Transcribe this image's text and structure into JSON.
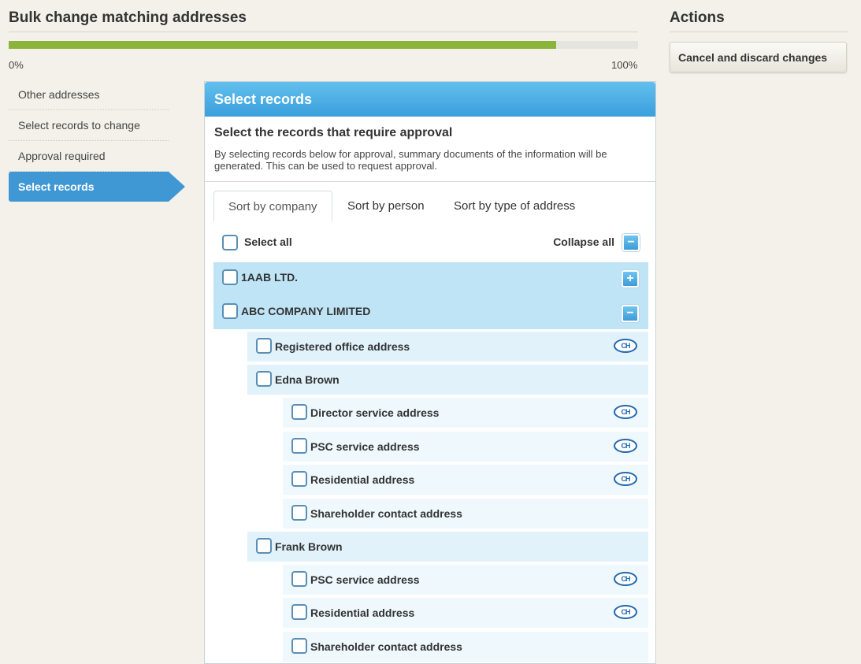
{
  "page": {
    "title": "Bulk change matching addresses"
  },
  "progress": {
    "value": 0.87,
    "min_label": "0%",
    "max_label": "100%"
  },
  "actions": {
    "title": "Actions",
    "cancel_label": "Cancel and discard changes"
  },
  "steps": [
    {
      "label": "Other addresses",
      "active": false
    },
    {
      "label": "Select records to change",
      "active": false
    },
    {
      "label": "Approval required",
      "active": false
    },
    {
      "label": "Select records",
      "active": true
    }
  ],
  "panel": {
    "title": "Select records",
    "subtitle": "Select the records that require approval",
    "description": "By selecting records below for approval, summary documents of the information will be generated. This can be used to request approval."
  },
  "tabs": [
    {
      "label": "Sort by company",
      "active": true
    },
    {
      "label": "Sort by person",
      "active": false
    },
    {
      "label": "Sort by type of address",
      "active": false
    }
  ],
  "controls": {
    "select_all": "Select all",
    "collapse_all": "Collapse all",
    "collapse_symbol": "−",
    "expand_symbol": "+"
  },
  "companies": [
    {
      "name": "1AAB LTD.",
      "expanded": false
    },
    {
      "name": "ABC COMPANY LIMITED",
      "expanded": true
    }
  ],
  "records": [
    {
      "label": "Registered office address",
      "ch": true
    },
    {
      "label": "Edna Brown"
    },
    {
      "label": "Director service address",
      "ch": true
    },
    {
      "label": "PSC service address",
      "ch": true
    },
    {
      "label": "Residential address",
      "ch": true
    },
    {
      "label": "Shareholder contact address",
      "ch": false
    },
    {
      "label": "Frank Brown"
    },
    {
      "label": "PSC service address",
      "ch": true
    },
    {
      "label": "Residential address",
      "ch": true
    },
    {
      "label": "Shareholder contact address",
      "ch": false
    }
  ],
  "icons": {
    "companies_house": "companies-house-icon",
    "ch_text": "CH"
  },
  "colors": {
    "accent": "#3f98d4",
    "progress": "#8cb43c",
    "company_row": "#bfe4f6"
  }
}
